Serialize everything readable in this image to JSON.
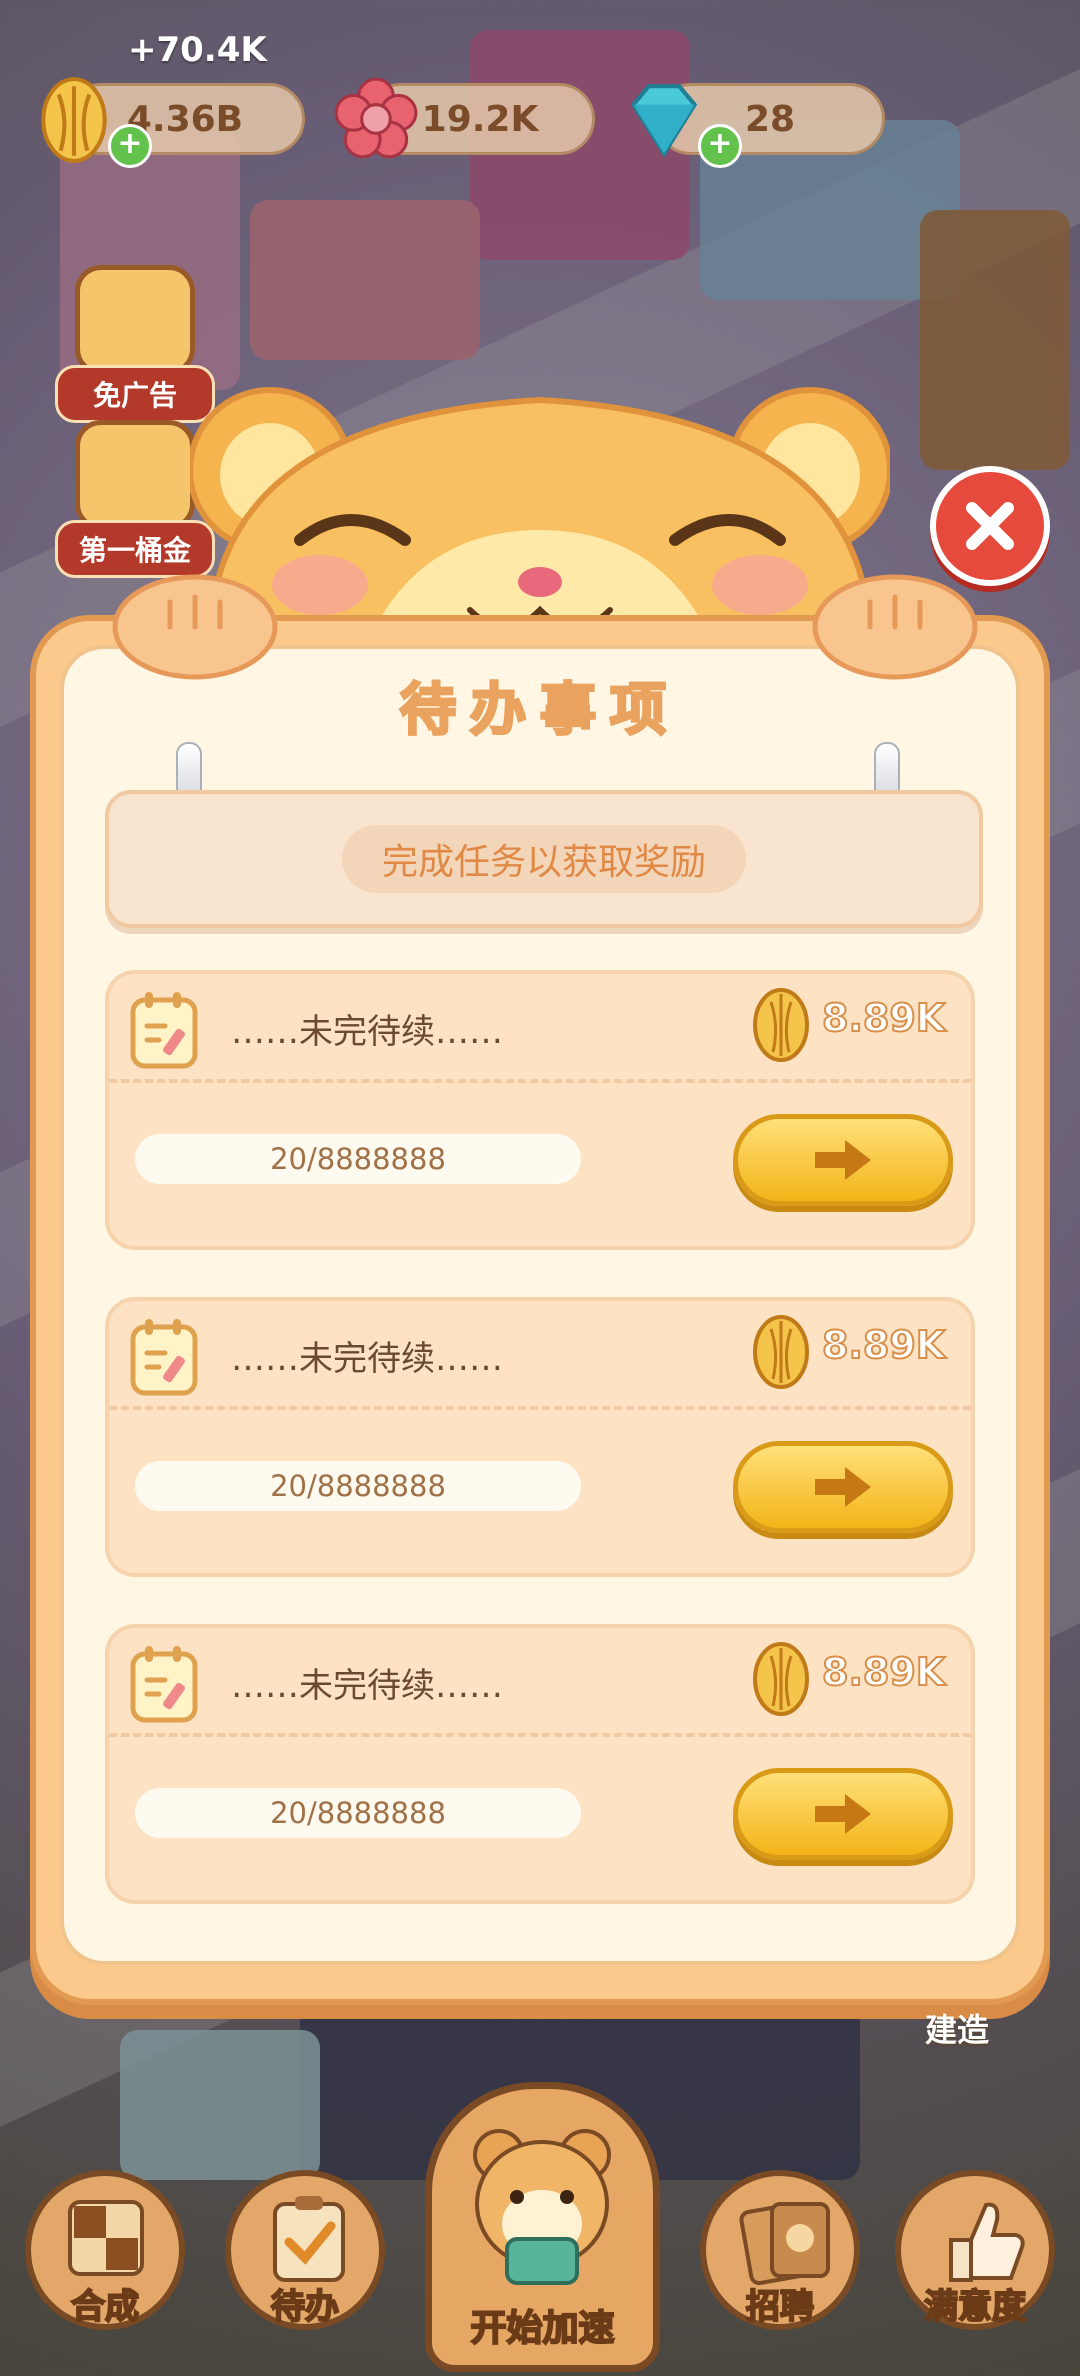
{
  "resources": {
    "income_popup": "+70.4K",
    "seeds": "4.36B",
    "flowers": "19.2K",
    "diamonds": "28"
  },
  "side_badges": [
    {
      "label": "免广告"
    },
    {
      "label": "第一桶金"
    }
  ],
  "modal": {
    "title": "待办事项",
    "banner": "完成任务以获取奖励",
    "tasks": [
      {
        "name": "……未完待续……",
        "reward": "8.89K",
        "progress": "20/8888888"
      },
      {
        "name": "……未完待续……",
        "reward": "8.89K",
        "progress": "20/8888888"
      },
      {
        "name": "……未完待续……",
        "reward": "8.89K",
        "progress": "20/8888888"
      }
    ]
  },
  "build_label": "建造",
  "nav": {
    "merge": "合成",
    "todo": "待办",
    "speed": "开始加速",
    "recruit": "招聘",
    "satisfaction": "满意度"
  },
  "colors": {
    "panel": "#fbc98c",
    "panel_inner": "#fff6e3",
    "accent_orange": "#e18845",
    "go_button": "#f3b418",
    "close_button": "#e64a3c"
  }
}
